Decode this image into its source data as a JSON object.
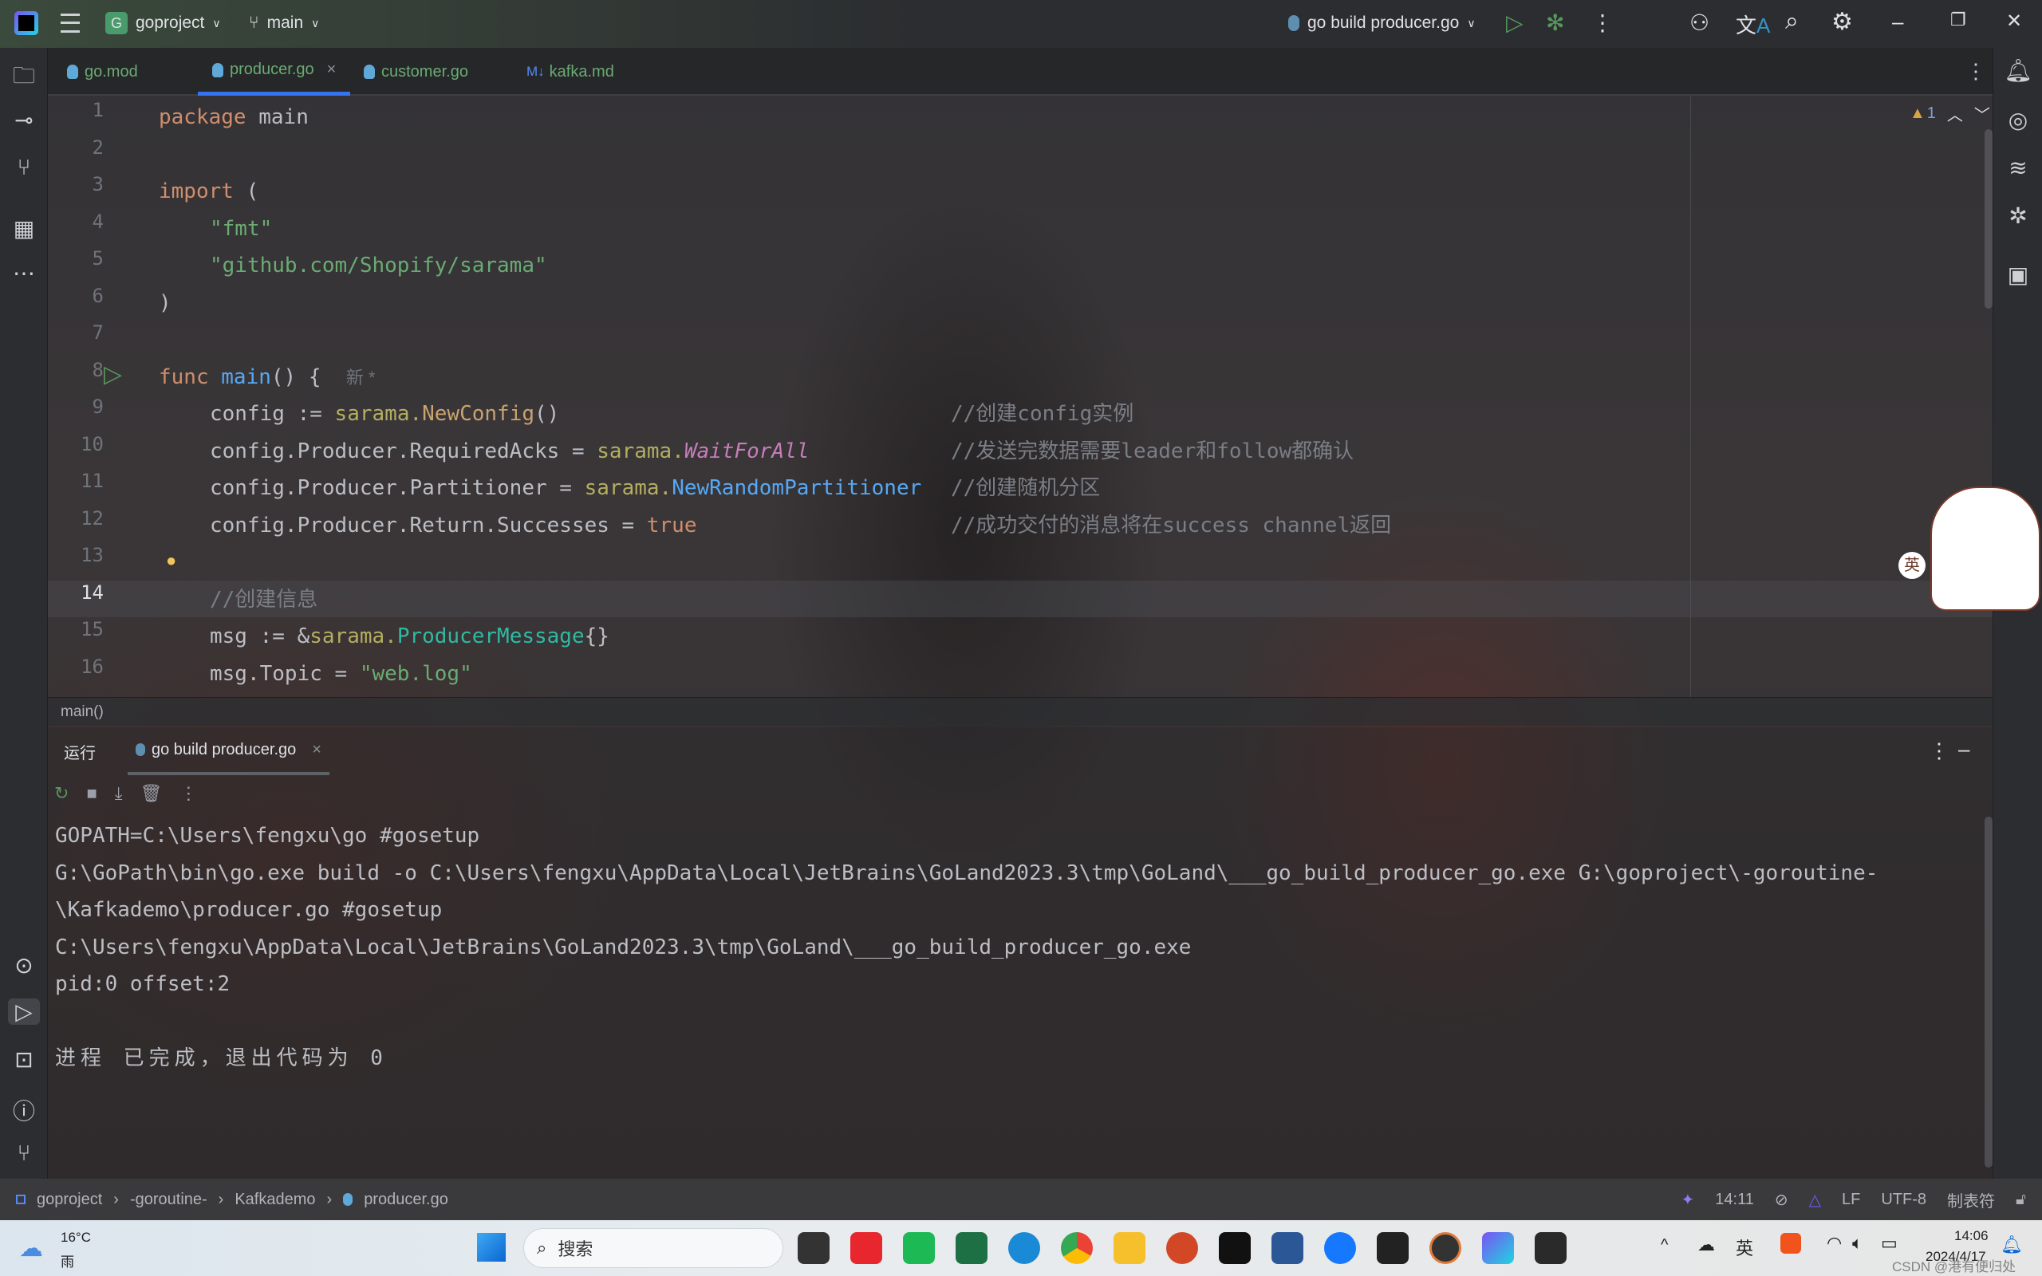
{
  "titlebar": {
    "project": "goproject",
    "project_badge": "G",
    "branch": "main",
    "run_config": "go build producer.go"
  },
  "tabs": [
    {
      "label": "go.mod"
    },
    {
      "label": "producer.go",
      "active": true
    },
    {
      "label": "customer.go"
    },
    {
      "label": "kafka.md",
      "prefix": "M↓"
    }
  ],
  "editor": {
    "warnings": "1",
    "line_numbers": [
      "1",
      "2",
      "3",
      "4",
      "5",
      "6",
      "7",
      "8",
      "9",
      "10",
      "11",
      "12",
      "13",
      "14",
      "15",
      "16"
    ],
    "lines": {
      "l1": [
        "package",
        "main"
      ],
      "l3": [
        "import",
        "("
      ],
      "l4": "\"fmt\"",
      "l5": "\"github.com/Shopify/sarama\"",
      "l6": ")",
      "l8": [
        "func",
        "main",
        "() {",
        "新 *"
      ],
      "l9": [
        "config := ",
        "sarama.",
        "NewConfig",
        "()",
        "//创建config实例"
      ],
      "l10": [
        "config.Producer.RequiredAcks = ",
        "sarama.",
        "WaitForAll",
        "//发送完数据需要leader和follow都确认"
      ],
      "l11": [
        "config.Producer.Partitioner = ",
        "sarama.",
        "NewRandomPartitioner",
        "//创建随机分区"
      ],
      "l12": [
        "config.Producer.Return.Successes = ",
        "true",
        "//成功交付的消息将在success channel返回"
      ],
      "l14": "//创建信息",
      "l15": [
        "msg := &",
        "sarama.",
        "ProducerMessage",
        "{}"
      ],
      "l16": [
        "msg.Topic = ",
        "\"web.log\""
      ]
    },
    "breadcrumb": "main()"
  },
  "run_panel": {
    "title": "运行",
    "tab": "go build producer.go",
    "output": [
      "GOPATH=C:\\Users\\fengxu\\go #gosetup",
      "G:\\GoPath\\bin\\go.exe build -o C:\\Users\\fengxu\\AppData\\Local\\JetBrains\\GoLand2023.3\\tmp\\GoLand\\___go_build_producer_go.exe G:\\goproject\\-goroutine-",
      "\\Kafkademo\\producer.go #gosetup",
      "C:\\Users\\fengxu\\AppData\\Local\\JetBrains\\GoLand2023.3\\tmp\\GoLand\\___go_build_producer_go.exe",
      "pid:0 offset:2",
      "",
      "进程 已完成，退出代码为 0"
    ]
  },
  "statusbar": {
    "path": [
      "goproject",
      "-goroutine-",
      "Kafkademo",
      "producer.go"
    ],
    "position": "14:11",
    "line_sep": "LF",
    "encoding": "UTF-8",
    "indent": "制表符"
  },
  "taskbar": {
    "weather_temp": "16°C",
    "weather_desc": "雨",
    "search_placeholder": "搜索",
    "time": "14:06",
    "date": "2024/4/17",
    "ime": "英",
    "watermark": "CSDN @港有便归处"
  },
  "overlay": {
    "ime_label": "英"
  }
}
